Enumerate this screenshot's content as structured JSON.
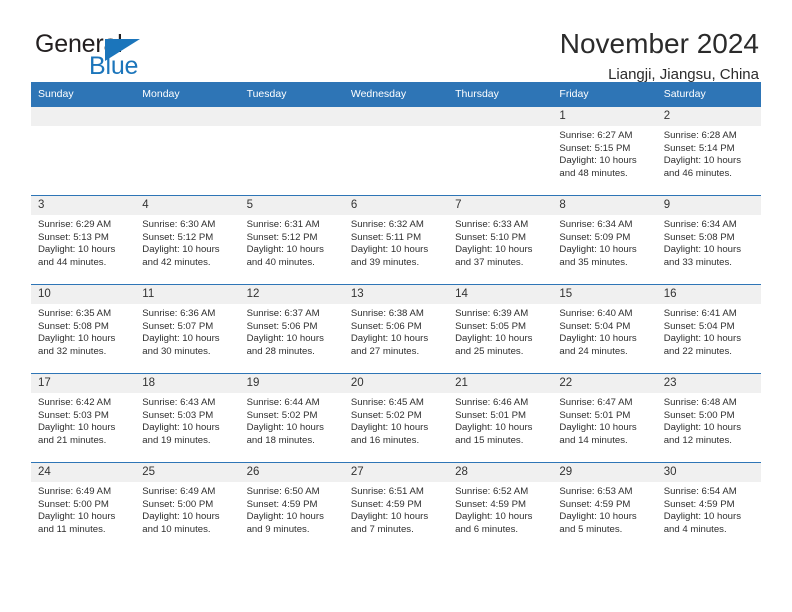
{
  "brand": {
    "name_part1": "General",
    "name_part2": "Blue",
    "logo_icon": "triangle-flag-icon",
    "accent_color": "#1b75bb"
  },
  "header": {
    "title": "November 2024",
    "location": "Liangji, Jiangsu, China"
  },
  "calendar": {
    "header_color": "#2e75b6",
    "daycell_header_color": "#f0f0f0",
    "weekday_names": [
      "Sunday",
      "Monday",
      "Tuesday",
      "Wednesday",
      "Thursday",
      "Friday",
      "Saturday"
    ],
    "labels": {
      "sunrise": "Sunrise:",
      "sunset": "Sunset:",
      "daylight": "Daylight:"
    },
    "weeks": [
      [
        {
          "day": "",
          "empty": true
        },
        {
          "day": "",
          "empty": true
        },
        {
          "day": "",
          "empty": true
        },
        {
          "day": "",
          "empty": true
        },
        {
          "day": "",
          "empty": true
        },
        {
          "day": "1",
          "sunrise": "Sunrise: 6:27 AM",
          "sunset": "Sunset: 5:15 PM",
          "daylight_line1": "Daylight: 10 hours",
          "daylight_line2": "and 48 minutes."
        },
        {
          "day": "2",
          "sunrise": "Sunrise: 6:28 AM",
          "sunset": "Sunset: 5:14 PM",
          "daylight_line1": "Daylight: 10 hours",
          "daylight_line2": "and 46 minutes."
        }
      ],
      [
        {
          "day": "3",
          "sunrise": "Sunrise: 6:29 AM",
          "sunset": "Sunset: 5:13 PM",
          "daylight_line1": "Daylight: 10 hours",
          "daylight_line2": "and 44 minutes."
        },
        {
          "day": "4",
          "sunrise": "Sunrise: 6:30 AM",
          "sunset": "Sunset: 5:12 PM",
          "daylight_line1": "Daylight: 10 hours",
          "daylight_line2": "and 42 minutes."
        },
        {
          "day": "5",
          "sunrise": "Sunrise: 6:31 AM",
          "sunset": "Sunset: 5:12 PM",
          "daylight_line1": "Daylight: 10 hours",
          "daylight_line2": "and 40 minutes."
        },
        {
          "day": "6",
          "sunrise": "Sunrise: 6:32 AM",
          "sunset": "Sunset: 5:11 PM",
          "daylight_line1": "Daylight: 10 hours",
          "daylight_line2": "and 39 minutes."
        },
        {
          "day": "7",
          "sunrise": "Sunrise: 6:33 AM",
          "sunset": "Sunset: 5:10 PM",
          "daylight_line1": "Daylight: 10 hours",
          "daylight_line2": "and 37 minutes."
        },
        {
          "day": "8",
          "sunrise": "Sunrise: 6:34 AM",
          "sunset": "Sunset: 5:09 PM",
          "daylight_line1": "Daylight: 10 hours",
          "daylight_line2": "and 35 minutes."
        },
        {
          "day": "9",
          "sunrise": "Sunrise: 6:34 AM",
          "sunset": "Sunset: 5:08 PM",
          "daylight_line1": "Daylight: 10 hours",
          "daylight_line2": "and 33 minutes."
        }
      ],
      [
        {
          "day": "10",
          "sunrise": "Sunrise: 6:35 AM",
          "sunset": "Sunset: 5:08 PM",
          "daylight_line1": "Daylight: 10 hours",
          "daylight_line2": "and 32 minutes."
        },
        {
          "day": "11",
          "sunrise": "Sunrise: 6:36 AM",
          "sunset": "Sunset: 5:07 PM",
          "daylight_line1": "Daylight: 10 hours",
          "daylight_line2": "and 30 minutes."
        },
        {
          "day": "12",
          "sunrise": "Sunrise: 6:37 AM",
          "sunset": "Sunset: 5:06 PM",
          "daylight_line1": "Daylight: 10 hours",
          "daylight_line2": "and 28 minutes."
        },
        {
          "day": "13",
          "sunrise": "Sunrise: 6:38 AM",
          "sunset": "Sunset: 5:06 PM",
          "daylight_line1": "Daylight: 10 hours",
          "daylight_line2": "and 27 minutes."
        },
        {
          "day": "14",
          "sunrise": "Sunrise: 6:39 AM",
          "sunset": "Sunset: 5:05 PM",
          "daylight_line1": "Daylight: 10 hours",
          "daylight_line2": "and 25 minutes."
        },
        {
          "day": "15",
          "sunrise": "Sunrise: 6:40 AM",
          "sunset": "Sunset: 5:04 PM",
          "daylight_line1": "Daylight: 10 hours",
          "daylight_line2": "and 24 minutes."
        },
        {
          "day": "16",
          "sunrise": "Sunrise: 6:41 AM",
          "sunset": "Sunset: 5:04 PM",
          "daylight_line1": "Daylight: 10 hours",
          "daylight_line2": "and 22 minutes."
        }
      ],
      [
        {
          "day": "17",
          "sunrise": "Sunrise: 6:42 AM",
          "sunset": "Sunset: 5:03 PM",
          "daylight_line1": "Daylight: 10 hours",
          "daylight_line2": "and 21 minutes."
        },
        {
          "day": "18",
          "sunrise": "Sunrise: 6:43 AM",
          "sunset": "Sunset: 5:03 PM",
          "daylight_line1": "Daylight: 10 hours",
          "daylight_line2": "and 19 minutes."
        },
        {
          "day": "19",
          "sunrise": "Sunrise: 6:44 AM",
          "sunset": "Sunset: 5:02 PM",
          "daylight_line1": "Daylight: 10 hours",
          "daylight_line2": "and 18 minutes."
        },
        {
          "day": "20",
          "sunrise": "Sunrise: 6:45 AM",
          "sunset": "Sunset: 5:02 PM",
          "daylight_line1": "Daylight: 10 hours",
          "daylight_line2": "and 16 minutes."
        },
        {
          "day": "21",
          "sunrise": "Sunrise: 6:46 AM",
          "sunset": "Sunset: 5:01 PM",
          "daylight_line1": "Daylight: 10 hours",
          "daylight_line2": "and 15 minutes."
        },
        {
          "day": "22",
          "sunrise": "Sunrise: 6:47 AM",
          "sunset": "Sunset: 5:01 PM",
          "daylight_line1": "Daylight: 10 hours",
          "daylight_line2": "and 14 minutes."
        },
        {
          "day": "23",
          "sunrise": "Sunrise: 6:48 AM",
          "sunset": "Sunset: 5:00 PM",
          "daylight_line1": "Daylight: 10 hours",
          "daylight_line2": "and 12 minutes."
        }
      ],
      [
        {
          "day": "24",
          "sunrise": "Sunrise: 6:49 AM",
          "sunset": "Sunset: 5:00 PM",
          "daylight_line1": "Daylight: 10 hours",
          "daylight_line2": "and 11 minutes."
        },
        {
          "day": "25",
          "sunrise": "Sunrise: 6:49 AM",
          "sunset": "Sunset: 5:00 PM",
          "daylight_line1": "Daylight: 10 hours",
          "daylight_line2": "and 10 minutes."
        },
        {
          "day": "26",
          "sunrise": "Sunrise: 6:50 AM",
          "sunset": "Sunset: 4:59 PM",
          "daylight_line1": "Daylight: 10 hours",
          "daylight_line2": "and 9 minutes."
        },
        {
          "day": "27",
          "sunrise": "Sunrise: 6:51 AM",
          "sunset": "Sunset: 4:59 PM",
          "daylight_line1": "Daylight: 10 hours",
          "daylight_line2": "and 7 minutes."
        },
        {
          "day": "28",
          "sunrise": "Sunrise: 6:52 AM",
          "sunset": "Sunset: 4:59 PM",
          "daylight_line1": "Daylight: 10 hours",
          "daylight_line2": "and 6 minutes."
        },
        {
          "day": "29",
          "sunrise": "Sunrise: 6:53 AM",
          "sunset": "Sunset: 4:59 PM",
          "daylight_line1": "Daylight: 10 hours",
          "daylight_line2": "and 5 minutes."
        },
        {
          "day": "30",
          "sunrise": "Sunrise: 6:54 AM",
          "sunset": "Sunset: 4:59 PM",
          "daylight_line1": "Daylight: 10 hours",
          "daylight_line2": "and 4 minutes."
        }
      ]
    ]
  }
}
